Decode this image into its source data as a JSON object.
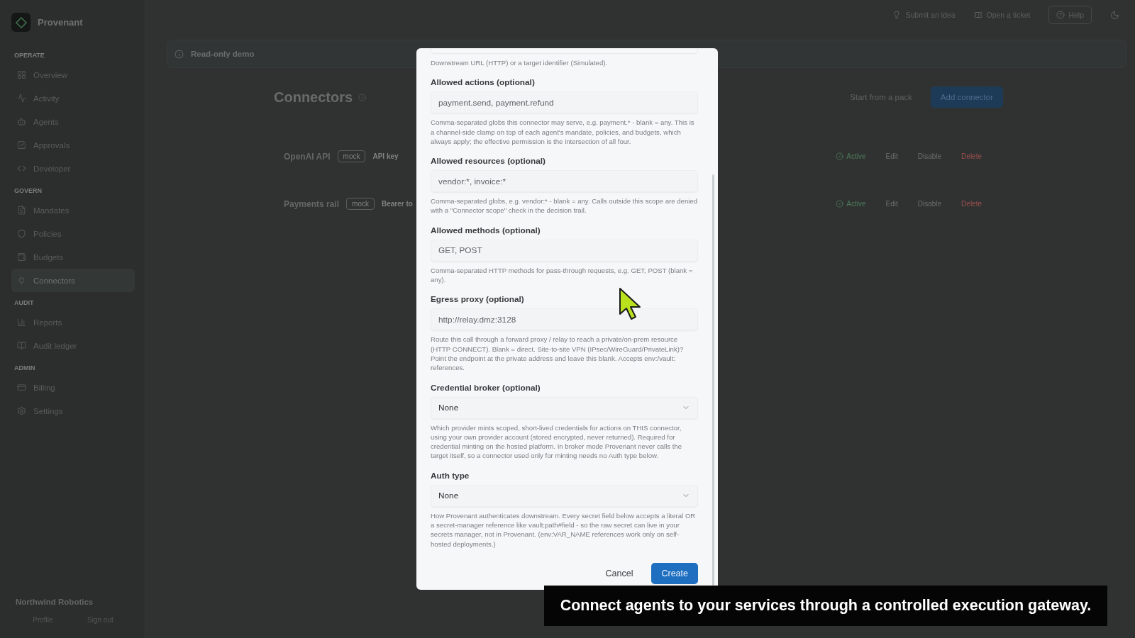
{
  "brand": {
    "name": "Provenant"
  },
  "sidebar": {
    "sections": [
      {
        "title": "OPERATE",
        "items": [
          {
            "label": "Overview",
            "selected": false
          },
          {
            "label": "Activity",
            "selected": false
          },
          {
            "label": "Agents",
            "selected": false
          },
          {
            "label": "Approvals",
            "selected": false
          },
          {
            "label": "Developer",
            "selected": false
          }
        ]
      },
      {
        "title": "GOVERN",
        "items": [
          {
            "label": "Mandates",
            "selected": false
          },
          {
            "label": "Policies",
            "selected": false
          },
          {
            "label": "Budgets",
            "selected": false
          },
          {
            "label": "Connectors",
            "selected": true
          }
        ]
      },
      {
        "title": "AUDIT",
        "items": [
          {
            "label": "Reports",
            "selected": false
          },
          {
            "label": "Audit ledger",
            "selected": false
          }
        ]
      },
      {
        "title": "ADMIN",
        "items": [
          {
            "label": "Billing",
            "selected": false
          },
          {
            "label": "Settings",
            "selected": false
          }
        ]
      }
    ],
    "org": "Northwind Robotics",
    "links": [
      "Profile",
      "Sign out"
    ]
  },
  "topbar": {
    "actions": [
      "Submit an idea",
      "Open a ticket"
    ],
    "help": "Help"
  },
  "banner": {
    "title": "Read-only demo"
  },
  "page": {
    "title": "Connectors",
    "secondary_button": "Start from a pack",
    "primary_button": "Add connector",
    "rows": [
      {
        "name": "OpenAI API",
        "tag": "mock",
        "auth": "API key",
        "status": "Active",
        "actions": [
          "Edit",
          "Disable",
          "Delete"
        ]
      },
      {
        "name": "Payments rail",
        "tag": "mock",
        "auth": "Bearer to",
        "status": "Active",
        "actions": [
          "Edit",
          "Disable",
          "Delete"
        ]
      }
    ]
  },
  "modal": {
    "top_hint": "Downstream URL (HTTP) or a target identifier (Simulated).",
    "fields": [
      {
        "kind": "input",
        "label": "Allowed actions (optional)",
        "value": "payment.send, payment.refund",
        "hint": "Comma-separated globs this connector may serve, e.g. payment.* - blank = any. This is a channel-side clamp on top of each agent's mandate, policies, and budgets, which always apply; the effective permission is the intersection of all four."
      },
      {
        "kind": "input",
        "label": "Allowed resources (optional)",
        "value": "vendor:*, invoice:*",
        "hint": "Comma-separated globs, e.g. vendor:* - blank = any. Calls outside this scope are denied with a \"Connector scope\" check in the decision trail."
      },
      {
        "kind": "input",
        "label": "Allowed methods (optional)",
        "value": "GET, POST",
        "hint": "Comma-separated HTTP methods for pass-through requests, e.g. GET, POST (blank = any)."
      },
      {
        "kind": "input",
        "label": "Egress proxy (optional)",
        "value": "http://relay.dmz:3128",
        "hint": "Route this call through a forward proxy / relay to reach a private/on-prem resource (HTTP CONNECT). Blank = direct. Site-to-site VPN (IPsec/WireGuard/PrivateLink)? Point the endpoint at the private address and leave this blank. Accepts env:/vault: references."
      },
      {
        "kind": "select",
        "label": "Credential broker (optional)",
        "value": "None",
        "hint": "Which provider mints scoped, short-lived credentials for actions on THIS connector, using your own provider account (stored encrypted, never returned). Required for credential minting on the hosted platform. In broker mode Provenant never calls the target itself, so a connector used only for minting needs no Auth type below."
      },
      {
        "kind": "select",
        "label": "Auth type",
        "value": "None",
        "hint": "How Provenant authenticates downstream. Every secret field below accepts a literal OR a secret-manager reference like vault:path#field - so the raw secret can live in your secrets manager, not in Provenant. (env:VAR_NAME references work only on self-hosted deployments.)"
      }
    ],
    "cancel": "Cancel",
    "submit": "Create"
  },
  "caption": "Connect agents to your services through a controlled execution gateway."
}
